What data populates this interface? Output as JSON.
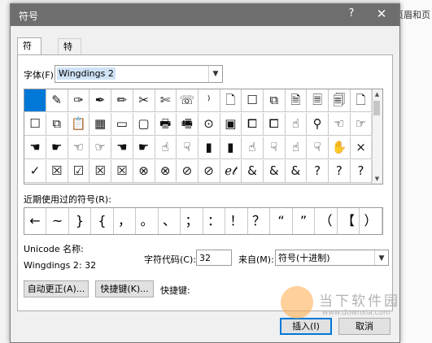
{
  "background": {
    "right_text": "页眉和页"
  },
  "dialog": {
    "title": "符号",
    "help": "?",
    "close": "✕",
    "tabs": [
      "符号(S)",
      "特殊字符(P)"
    ],
    "font_label": "字体(F):",
    "font_value": "Wingdings 2",
    "grid": [
      [
        "",
        "✎",
        "✑",
        "✒",
        "✏",
        "✂",
        "✄",
        "☏",
        "⁾",
        "🗋",
        "☐",
        "⧉",
        "🗎",
        "🗏",
        "🗐",
        "🗋"
      ],
      [
        "☐",
        "⧉",
        "📋",
        "▦",
        "▭",
        "▢",
        "🖶",
        "🖷",
        "⊙",
        "▣",
        "⧠",
        "⧠",
        "☝",
        "⚲",
        "☜",
        "☞"
      ],
      [
        "☚",
        "☛",
        "☜",
        "☞",
        "☚",
        "☛",
        "☝",
        "☟",
        "▮",
        "▮",
        "☝",
        "☟",
        "☝",
        "☟",
        "✋",
        "×"
      ],
      [
        "✓",
        "☒",
        "☑",
        "☒",
        "☒",
        "⊗",
        "⊗",
        "⊘",
        "⊘",
        "ℯ𝓉",
        "&",
        "&",
        "&",
        "?",
        "?",
        "?"
      ]
    ],
    "recent_label": "近期使用过的符号(R):",
    "recent": [
      "←",
      "~",
      "}",
      "{",
      "，",
      "。",
      "、",
      "；",
      "：",
      "！",
      "？",
      "“",
      "”",
      "（",
      "【",
      "）"
    ],
    "unicode_label": "Unicode 名称:",
    "unicode_value": "Wingdings 2: 32",
    "code_label": "字符代码(C):",
    "code_value": "32",
    "from_label": "来自(M):",
    "from_value": "符号(十进制)",
    "autocorrect_button": "自动更正(A)...",
    "shortcut_button": "快捷键(K)...",
    "shortcut_label": "快捷键:",
    "insert_button": "插入(I)",
    "cancel_button": "取消"
  },
  "watermark": {
    "text": "当下软件园",
    "url": "www.downxia.com"
  }
}
